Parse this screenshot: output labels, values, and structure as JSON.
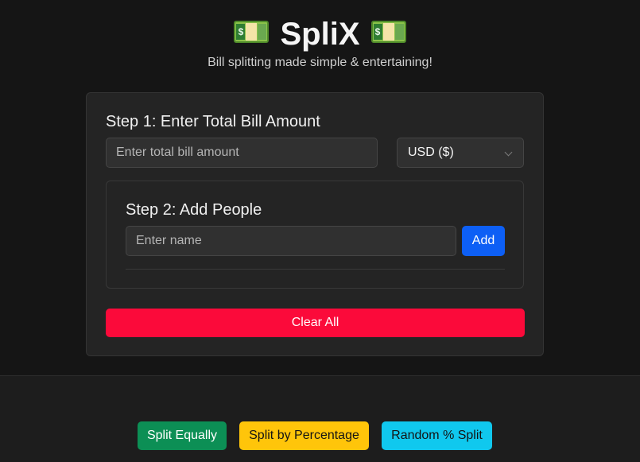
{
  "header": {
    "title": "SpliX",
    "subtitle": "Bill splitting made simple & entertaining!",
    "icon_left": "money-bill-icon",
    "icon_right": "money-bill-icon",
    "icon_symbol": "$"
  },
  "step1": {
    "label": "Step 1: Enter Total Bill Amount",
    "amount_value": "",
    "amount_placeholder": "Enter total bill amount",
    "currency_selected": "USD ($)"
  },
  "step2": {
    "label": "Step 2: Add People",
    "name_value": "",
    "name_placeholder": "Enter name",
    "add_label": "Add"
  },
  "actions": {
    "clear_label": "Clear All"
  },
  "split_options": {
    "equal_label": "Split Equally",
    "percent_label": "Split by Percentage",
    "random_label": "Random % Split"
  },
  "colors": {
    "background": "#151515",
    "card": "#242424",
    "add_button": "#0d5ff5",
    "clear_button": "#fb0a3a",
    "split_equal": "#0c8f55",
    "split_percent": "#ffc50a",
    "split_random": "#10c8ee"
  }
}
